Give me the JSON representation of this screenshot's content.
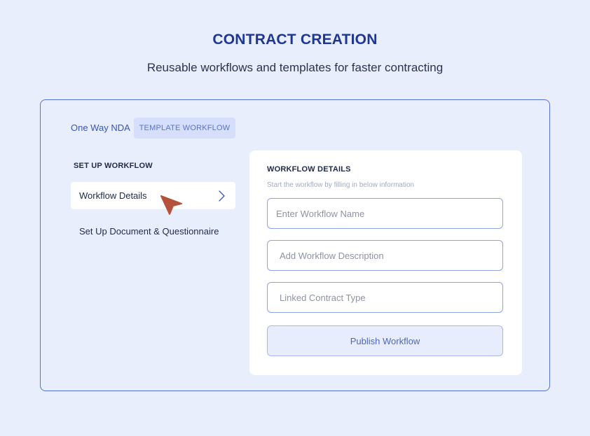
{
  "header": {
    "title": "CONTRACT CREATION",
    "subtitle": "Reusable workflows and templates for faster contracting"
  },
  "crumb": {
    "name": "One Way NDA",
    "tag": "TEMPLATE WORKFLOW"
  },
  "sidebar": {
    "heading": "SET UP WORKFLOW",
    "items": [
      {
        "label": "Workflow Details",
        "active": true,
        "icon": "chevron-right-icon"
      },
      {
        "label": "Set Up Document & Questionnaire",
        "active": false
      }
    ]
  },
  "panel": {
    "heading": "WORKFLOW DETAILS",
    "hint": "Start the workflow by filling in below information",
    "fields": [
      {
        "placeholder": "Enter Workflow Name",
        "value": ""
      },
      {
        "placeholder": "Add Workflow Description",
        "value": ""
      },
      {
        "placeholder": "Linked Contract Type",
        "value": ""
      }
    ],
    "publish_label": "Publish Workflow"
  },
  "colors": {
    "accent": "#1e3794",
    "background": "#e8eefc",
    "cursor": "#b5523c"
  }
}
